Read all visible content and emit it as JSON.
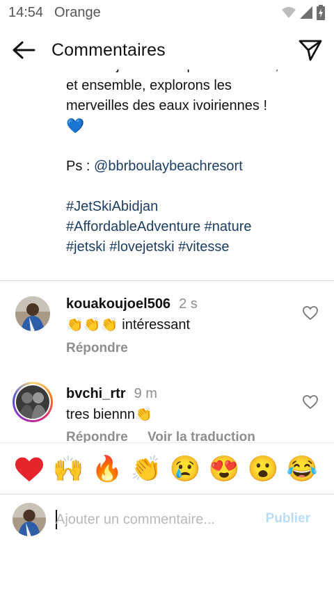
{
  "status_bar": {
    "time": "14:54",
    "carrier": "Orange",
    "icons": [
      "wifi-icon",
      "signal-icon",
      "battery-charging-icon"
    ]
  },
  "header": {
    "title": "Commentaires",
    "back_icon": "arrow-left-icon",
    "share_icon": "send-icon"
  },
  "caption": {
    "cut_line": "faire du jet ski à un prix abordable,",
    "line2": "et ensemble, explorons les",
    "line3": "merveilles des eaux ivoiriennes !",
    "emoji": "💙",
    "ps_prefix": "Ps : ",
    "ps_mention": "@bbrboulaybeachresort",
    "hashtags_line1": " #JetSkiAbidjan",
    "hashtags_line2": "#AffordableAdventure #nature",
    "hashtags_line3": "#jetski #lovejetski #vitesse"
  },
  "comments": [
    {
      "username": "kouakoujoel506",
      "time": "2 s",
      "emoji_prefix": "👏👏👏",
      "text": " intéressant",
      "reply_label": "Répondre"
    },
    {
      "username": "bvchi_rtr",
      "time": "9 m",
      "text": "tres biennn",
      "emoji_suffix": "👏",
      "reply_label": "Répondre",
      "translate_label": "Voir la traduction"
    }
  ],
  "emoji_bar": [
    "❤️",
    "🙌",
    "🔥",
    "👏",
    "😢",
    "😍",
    "😮",
    "😂"
  ],
  "input": {
    "placeholder": "Ajouter un commentaire...",
    "value": "",
    "publish_label": "Publier"
  },
  "colors": {
    "link": "#1d3e63",
    "muted": "#8e8e8e",
    "publish_disabled": "#b9dcf8"
  }
}
